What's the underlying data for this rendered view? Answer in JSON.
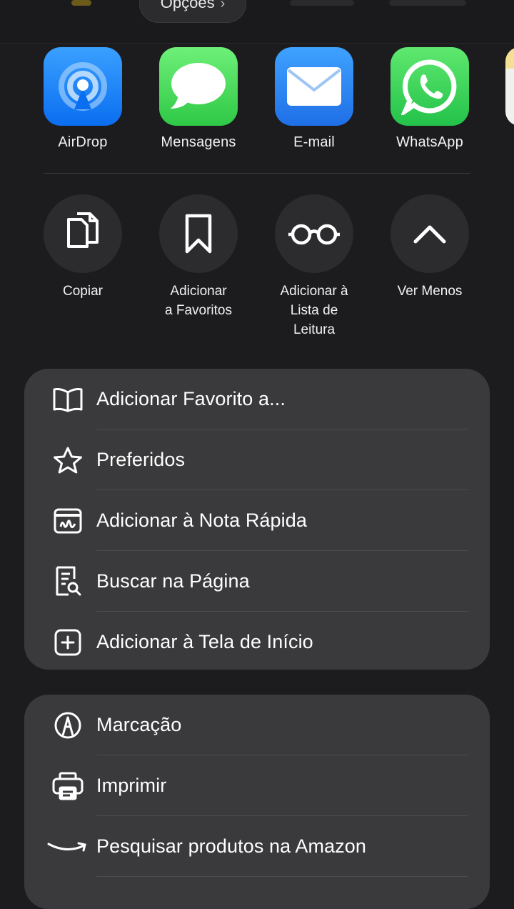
{
  "header": {
    "options_label": "Opções",
    "options_chevron": "›"
  },
  "apps": [
    {
      "label": "AirDrop",
      "icon": "airdrop-icon",
      "color": "#1a84ff"
    },
    {
      "label": "Mensagens",
      "icon": "messages-icon",
      "color": "#3dd150"
    },
    {
      "label": "E-mail",
      "icon": "mail-icon",
      "color": "#2f8cf7"
    },
    {
      "label": "WhatsApp",
      "icon": "whatsapp-icon",
      "color": "#2fd25a"
    }
  ],
  "actions": [
    {
      "label": "Copiar",
      "icon": "copy-icon"
    },
    {
      "label": "Adicionar\na Favoritos",
      "icon": "bookmark-icon"
    },
    {
      "label": "Adicionar à\nLista de\nLeitura",
      "icon": "glasses-icon"
    },
    {
      "label": "Ver Menos",
      "icon": "chevron-up-icon"
    }
  ],
  "group1": [
    {
      "label": "Adicionar Favorito a...",
      "icon": "book-icon"
    },
    {
      "label": "Preferidos",
      "icon": "star-icon"
    },
    {
      "label": "Adicionar à Nota Rápida",
      "icon": "quick-note-icon"
    },
    {
      "label": "Buscar na Página",
      "icon": "find-in-page-icon"
    },
    {
      "label": "Adicionar à Tela de Início",
      "icon": "add-square-icon"
    }
  ],
  "group2": [
    {
      "label": "Marcação",
      "icon": "markup-icon"
    },
    {
      "label": "Imprimir",
      "icon": "printer-icon"
    },
    {
      "label": "Pesquisar produtos na Amazon",
      "icon": "amazon-icon"
    }
  ],
  "colors": {
    "background": "#1c1c1e",
    "group_bg": "#3a3a3c",
    "circle_bg": "#2c2c2e"
  }
}
